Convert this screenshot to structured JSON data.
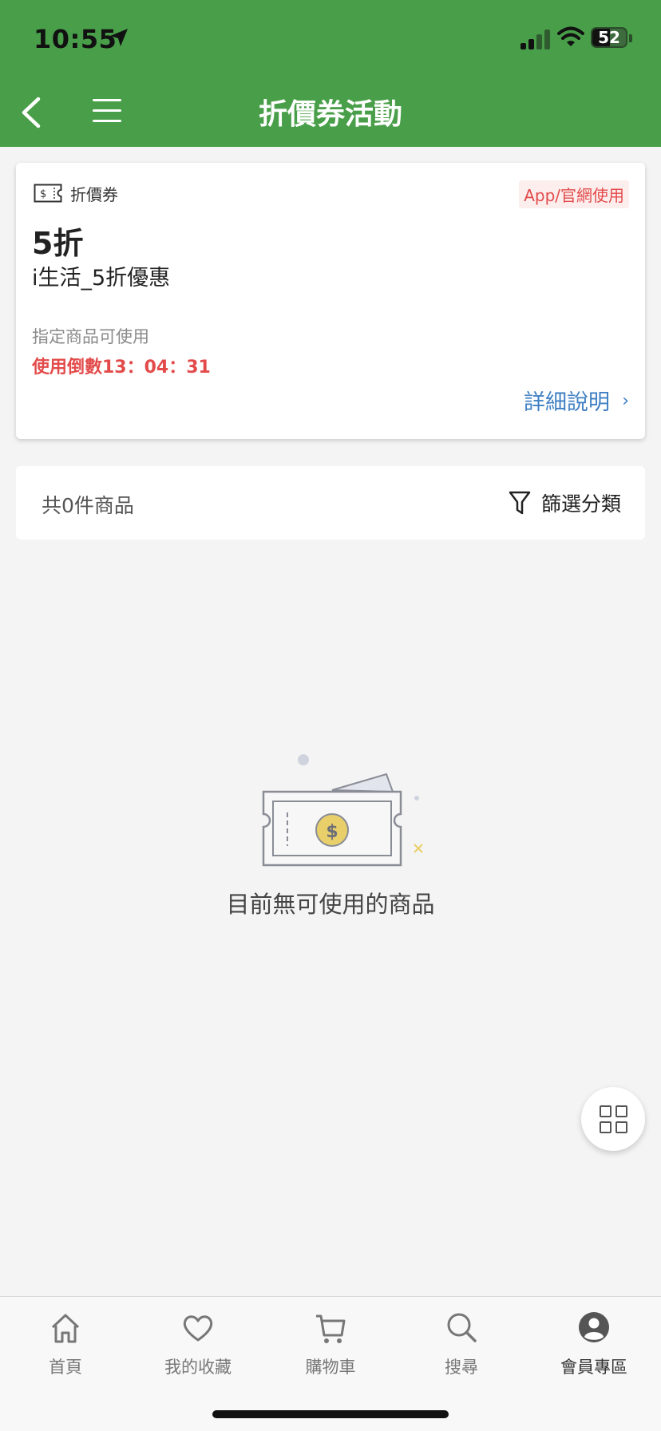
{
  "status_bar": {
    "time": "10:55",
    "battery": "52"
  },
  "header": {
    "title": "折價券活動"
  },
  "coupon": {
    "type_label": "折價券",
    "usage_badge": "App/官網使用",
    "discount": "5折",
    "name": "i生活_5折優惠",
    "condition": "指定商品可使用",
    "countdown": "使用倒數13：04：31",
    "detail_link": "詳細說明",
    "detail_chevron": "›"
  },
  "filter_bar": {
    "count_text": "共0件商品",
    "filter_label": "篩選分類"
  },
  "empty_state": {
    "message": "目前無可使用的商品"
  },
  "bottom_nav": {
    "items": [
      {
        "label": "首頁",
        "icon": "home-icon"
      },
      {
        "label": "我的收藏",
        "icon": "heart-icon"
      },
      {
        "label": "購物車",
        "icon": "cart-icon"
      },
      {
        "label": "搜尋",
        "icon": "search-icon"
      },
      {
        "label": "會員專區",
        "icon": "member-icon"
      }
    ]
  },
  "colors": {
    "header_green": "#499f49",
    "accent_red": "#e34b4b",
    "link_blue": "#3f7fc4",
    "coin_yellow": "#e8cf6a"
  }
}
